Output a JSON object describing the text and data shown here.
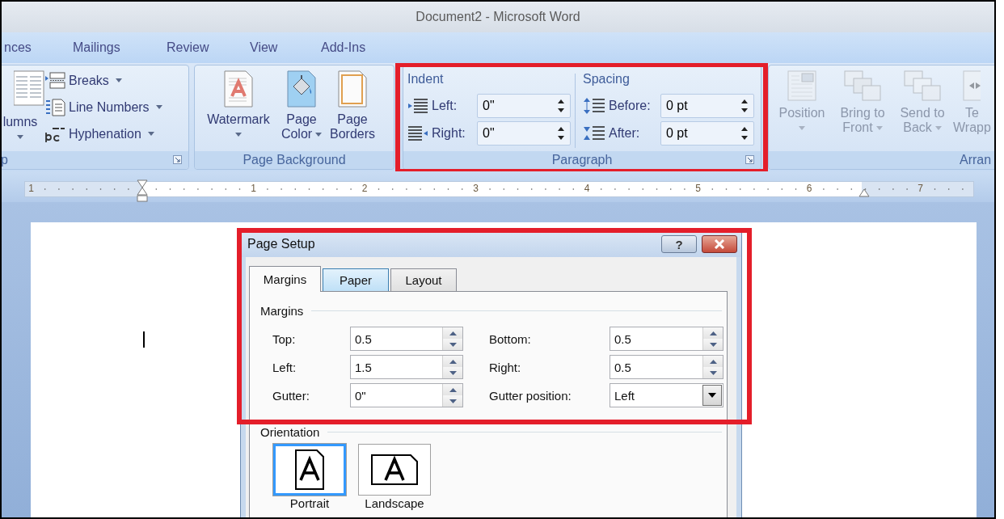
{
  "window": {
    "title": "Document2 - Microsoft Word"
  },
  "ribbon_tabs": [
    {
      "label": "nces"
    },
    {
      "label": "Mailings"
    },
    {
      "label": "Review"
    },
    {
      "label": "View"
    },
    {
      "label": "Add-Ins"
    }
  ],
  "ribbon_groups": [
    {
      "kind": "page_setup",
      "label": "p",
      "columns_button": {
        "label": "lumns",
        "dropdown": true
      },
      "items": [
        {
          "label": "Breaks",
          "dropdown": true
        },
        {
          "label": "Line Numbers",
          "dropdown": true
        },
        {
          "label": "Hyphenation",
          "dropdown": true
        }
      ]
    },
    {
      "kind": "page_background",
      "label": "Page Background",
      "buttons": [
        {
          "lines": [
            "Watermark"
          ],
          "dropdown": true,
          "disabled": false
        },
        {
          "lines": [
            "Page",
            "Color"
          ],
          "dropdown": true,
          "disabled": false
        },
        {
          "lines": [
            "Page",
            "Borders"
          ],
          "dropdown": false,
          "disabled": false
        }
      ]
    },
    {
      "kind": "paragraph",
      "label": "Paragraph",
      "highlighted": true,
      "indent": {
        "heading": "Indent",
        "fields": [
          {
            "label": "Left:",
            "value": "0\""
          },
          {
            "label": "Right:",
            "value": "0\""
          }
        ]
      },
      "spacing": {
        "heading": "Spacing",
        "fields": [
          {
            "label": "Before:",
            "value": "0 pt"
          },
          {
            "label": "After:",
            "value": "0 pt"
          }
        ]
      }
    },
    {
      "kind": "arrange",
      "label": "Arran",
      "buttons": [
        {
          "lines": [
            "Position"
          ],
          "dropdown": true,
          "disabled": true
        },
        {
          "lines": [
            "Bring to",
            "Front"
          ],
          "dropdown": true,
          "disabled": true
        },
        {
          "lines": [
            "Send to",
            "Back"
          ],
          "dropdown": true,
          "disabled": true
        },
        {
          "lines": [
            "Te",
            "Wrapp"
          ],
          "dropdown": false,
          "disabled": true
        }
      ]
    }
  ],
  "ruler": {
    "labels": [
      "1",
      "1",
      "2",
      "3",
      "4",
      "5",
      "6",
      "7"
    ]
  },
  "dialog": {
    "title": "Page Setup",
    "help_label": "?",
    "highlighted": true,
    "tabs": [
      {
        "label": "Margins",
        "selected": true,
        "hovered": false
      },
      {
        "label": "Paper",
        "selected": false,
        "hovered": true
      },
      {
        "label": "Layout",
        "selected": false,
        "hovered": false
      }
    ],
    "margins": {
      "heading": "Margins",
      "fields": [
        {
          "kind": "spin",
          "label": "Top:",
          "value": "0.5"
        },
        {
          "kind": "spin",
          "label": "Bottom:",
          "value": "0.5"
        },
        {
          "kind": "spin",
          "label": "Left:",
          "value": "1.5"
        },
        {
          "kind": "spin",
          "label": "Right:",
          "value": "0.5"
        },
        {
          "kind": "spin",
          "label": "Gutter:",
          "value": "0\""
        },
        {
          "kind": "dropdown",
          "label": "Gutter position:",
          "value": "Left"
        }
      ]
    },
    "orientation": {
      "heading": "Orientation",
      "options": [
        {
          "label": "Portrait",
          "selected": true
        },
        {
          "label": "Landscape",
          "selected": false
        }
      ]
    }
  }
}
